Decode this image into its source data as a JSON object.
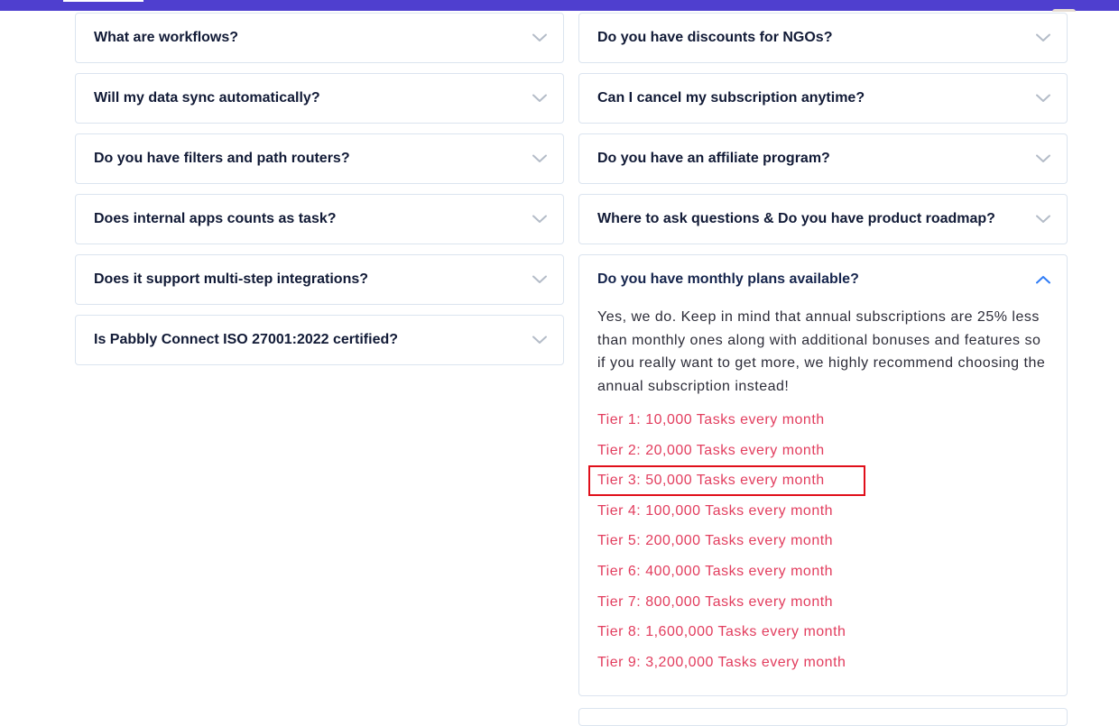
{
  "colors": {
    "header_bar": "#4f3fcf",
    "question_text": "#111a36",
    "tier_text": "#e23d5e",
    "highlight_box": "#e00f1a",
    "chevron_closed": "#b4bcc8",
    "chevron_open": "#2f7cf6"
  },
  "faq_left": [
    {
      "question": "What are workflows?",
      "icon": "chevron-down-icon"
    },
    {
      "question": "Will my data sync automatically?",
      "icon": "chevron-down-icon"
    },
    {
      "question": "Do you have filters and path routers?",
      "icon": "chevron-down-icon"
    },
    {
      "question": "Does internal apps counts as task?",
      "icon": "chevron-down-icon"
    },
    {
      "question": "Does it support multi-step integrations?",
      "icon": "chevron-down-icon"
    },
    {
      "question": "Is Pabbly Connect ISO 27001:2022 certified?",
      "icon": "chevron-down-icon"
    }
  ],
  "faq_right": [
    {
      "question": "Do you have discounts for NGOs?",
      "icon": "chevron-down-icon"
    },
    {
      "question": "Can I cancel my subscription anytime?",
      "icon": "chevron-down-icon"
    },
    {
      "question": "Do you have an affiliate program?",
      "icon": "chevron-down-icon"
    },
    {
      "question": "Where to ask questions & Do you have product roadmap?",
      "icon": "chevron-down-icon"
    }
  ],
  "open_faq": {
    "question": "Do you have monthly plans available?",
    "icon": "chevron-up-icon",
    "answer": "Yes, we do. Keep in mind that annual subscriptions are 25% less than monthly ones along with additional bonuses and features so if you really want to get more, we highly recommend choosing the annual subscription instead!",
    "tiers": [
      "Tier 1: 10,000 Tasks every month",
      "Tier 2: 20,000 Tasks every month",
      "Tier 3: 50,000 Tasks every month",
      "Tier 4: 100,000 Tasks every month",
      "Tier 5: 200,000 Tasks every month",
      "Tier 6: 400,000 Tasks every month",
      "Tier 7: 800,000 Tasks every month",
      "Tier 8: 1,600,000 Tasks every month",
      "Tier 9: 3,200,000 Tasks every month"
    ],
    "highlighted_tier": "Tier 3: 50,000 Tasks every month"
  }
}
